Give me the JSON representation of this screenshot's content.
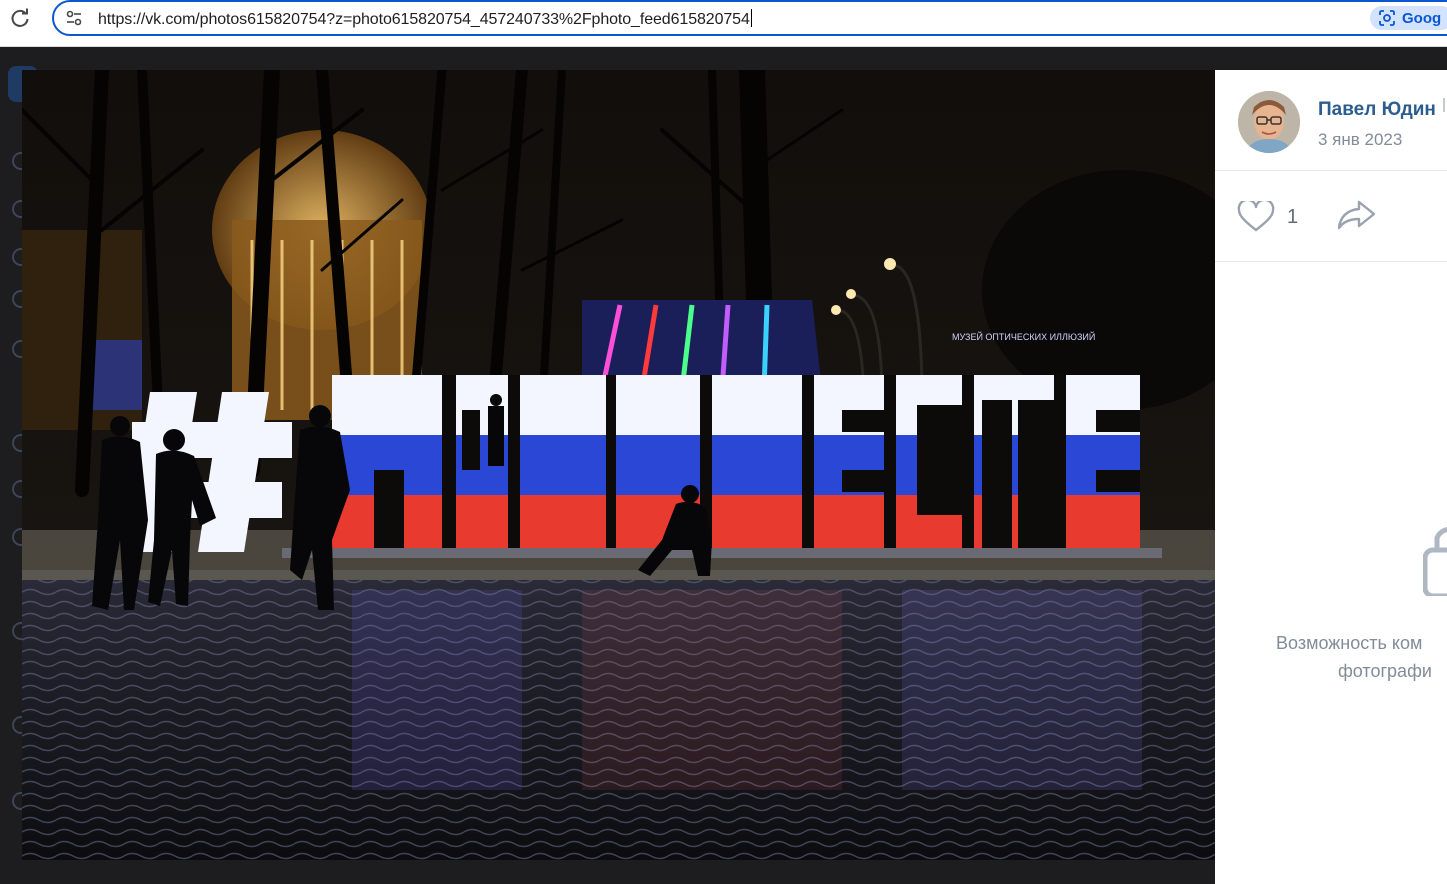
{
  "browser": {
    "url": "https://vk.com/photos615820754?z=photo615820754_457240733%2Fphoto_feed615820754",
    "lens_label": "Goog"
  },
  "photo": {
    "sign_text": "#МЫВМЕСТЕ",
    "background_sign": "МУЗЕЙ ОПТИЧЕСКИХ ИЛЛЮЗИЙ"
  },
  "author": {
    "name": "Павел Юдин",
    "date": "3 янв 2023"
  },
  "actions": {
    "like_count": "1"
  },
  "comments": {
    "closed_line1": "Возможность ком",
    "closed_line2": "фотографи"
  },
  "colors": {
    "accent": "#0b57d0",
    "author_link": "#2c5d8f",
    "muted_text": "#818c99",
    "flag_white": "#f4f6ff",
    "flag_blue": "#2a47d6",
    "flag_red": "#e83a2e"
  }
}
